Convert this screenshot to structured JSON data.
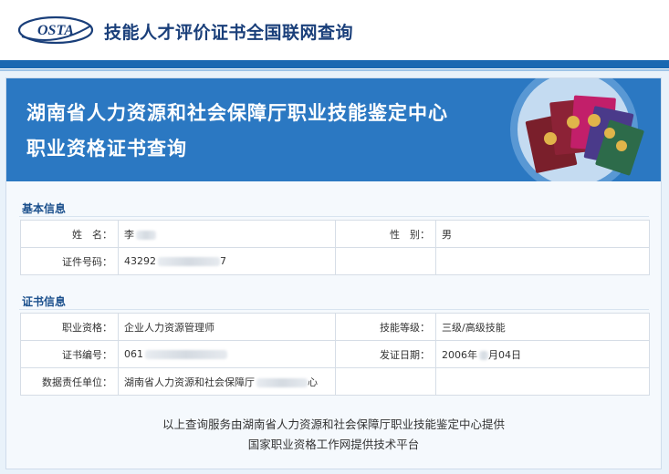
{
  "header": {
    "logo_text": "OSTA",
    "site_title": "技能人才评价证书全国联网查询"
  },
  "banner": {
    "title_line1": "湖南省人力资源和社会保障厅职业技能鉴定中心",
    "title_line2": "职业资格证书查询"
  },
  "basic_info": {
    "section_title": "基本信息",
    "name_label": "姓　名：",
    "name_value": "李",
    "gender_label": "性　别：",
    "gender_value": "男",
    "id_label": "证件号码：",
    "id_value": "43292",
    "id_value_tail": "7"
  },
  "cert_info": {
    "section_title": "证书信息",
    "occupation_label": "职业资格：",
    "occupation_value": "企业人力资源管理师",
    "level_label": "技能等级：",
    "level_value": "三级/高级技能",
    "cert_no_label": "证书编号：",
    "cert_no_value": "061",
    "issue_date_label": "发证日期：",
    "issue_date_value_pre": "2006年",
    "issue_date_value_post": "月04日",
    "unit_label": "数据责任单位：",
    "unit_value_pre": "湖南省人力资源和社会保障厅",
    "unit_value_post": "心"
  },
  "footer": {
    "line1": "以上查询服务由湖南省人力资源和社会保障厅职业技能鉴定中心提供",
    "line2": "国家职业资格工作网提供技术平台"
  },
  "colors": {
    "banner_blue": "#2b78c2",
    "header_rule": "#1a67b1",
    "title_navy": "#1a3f7a",
    "section_blue": "#1a4f8c"
  }
}
